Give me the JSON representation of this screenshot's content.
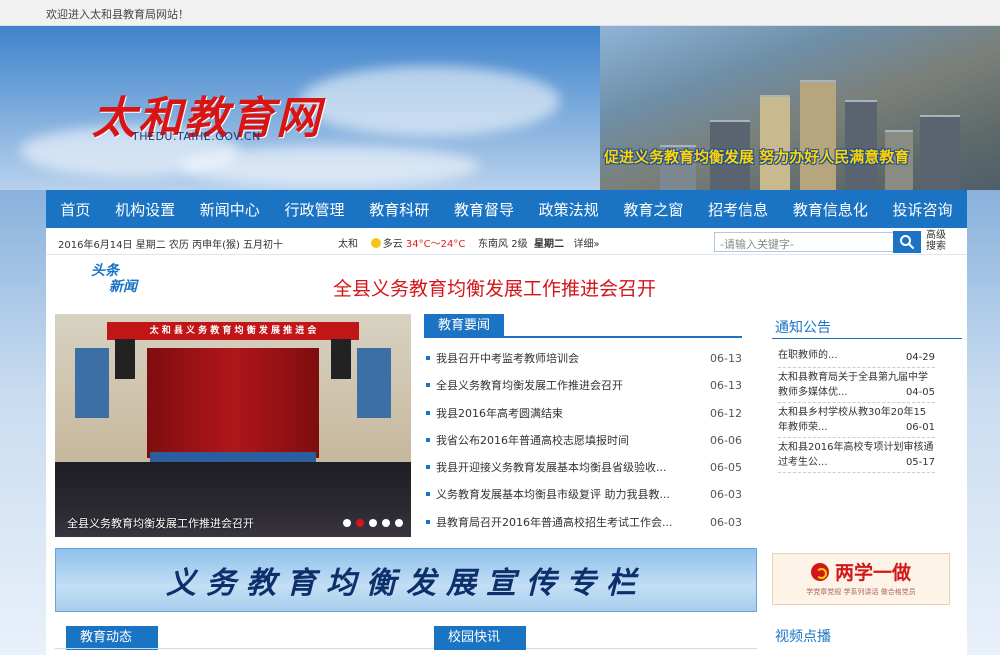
{
  "topbar": {
    "welcome": "欢迎进入太和县教育局网站！"
  },
  "header": {
    "logo_cn": "太和教育网",
    "logo_en": "THEDU.TAIHE.GOV.CN",
    "slogan": "促进义务教育均衡发展  努力办好人民满意教育"
  },
  "nav": [
    "首页",
    "机构设置",
    "新闻中心",
    "行政管理",
    "教育科研",
    "教育督导",
    "政策法规",
    "教育之窗",
    "招考信息",
    "教育信息化",
    "投诉咨询"
  ],
  "infobar": {
    "date": "2016年6月14日 星期二 农历 丙申年(猴) 五月初十",
    "city": "太和",
    "weather": "多云",
    "temp": "34°C～24°C",
    "wind": "东南风  2级",
    "weekday": "星期二",
    "detail": "详细»",
    "search_placeholder": "-请输入关键字-",
    "advanced": "高级搜索"
  },
  "headline": {
    "tag1": "头条",
    "tag2": "新闻",
    "title": "全县义务教育均衡发展工作推进会召开"
  },
  "slideshow": {
    "banner": "太 和 县 义 务 教 育 均 衡 发 展 推 进 会",
    "caption": "全县义务教育均衡发展工作推进会召开",
    "active_index": 1,
    "count": 5
  },
  "news": {
    "title": "教育要闻",
    "items": [
      {
        "t": "我县召开中考监考教师培训会",
        "d": "06-13"
      },
      {
        "t": "全县义务教育均衡发展工作推进会召开",
        "d": "06-13"
      },
      {
        "t": "我县2016年高考圆满结束",
        "d": "06-12"
      },
      {
        "t": "我省公布2016年普通高校志愿填报时间",
        "d": "06-06"
      },
      {
        "t": "我县开迎接义务教育发展基本均衡县省级验收...",
        "d": "06-05"
      },
      {
        "t": "义务教育发展基本均衡县市级复评 助力我县教...",
        "d": "06-03"
      },
      {
        "t": "县教育局召开2016年普通高校招生考试工作会...",
        "d": "06-03"
      }
    ]
  },
  "notice": {
    "title": "通知公告",
    "items": [
      {
        "t": "在职教师的...",
        "d": "04-29"
      },
      {
        "t": "太和县教育局关于全县第九届中学教师多媒体优...",
        "d": "04-05"
      },
      {
        "t": "太和县乡村学校从教30年20年15年教师荣...",
        "d": "06-01"
      },
      {
        "t": "太和县2016年高校专项计划审核通过考生公...",
        "d": "05-17"
      }
    ]
  },
  "promo": {
    "text": "义务教育均衡发展宣传专栏"
  },
  "lxyz": {
    "text": "两学一做",
    "sub": "学党章党规 学系列讲话 做合格党员"
  },
  "bottom": {
    "tab1": "教育动态",
    "tab2": "校园快讯",
    "video": "视频点播"
  },
  "colors": {
    "brand": "#1b74c3",
    "accent": "#d3161a"
  }
}
